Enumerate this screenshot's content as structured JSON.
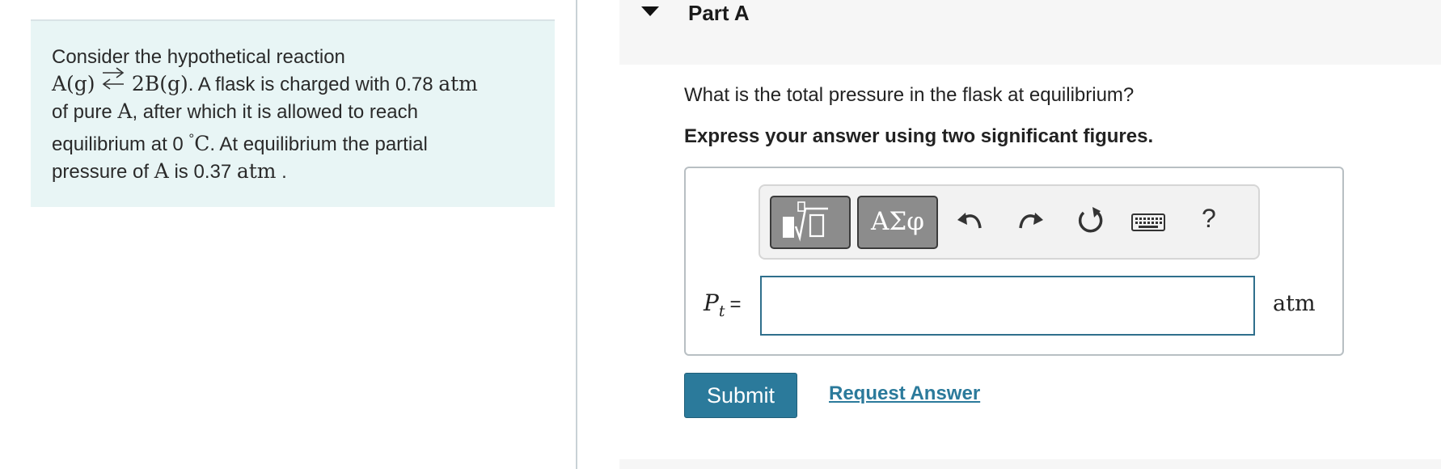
{
  "problem": {
    "intro": "Consider the hypothetical reaction",
    "reactant": "A(g)",
    "product": "2B(g)",
    "text_after_eq": ". A flask is charged with 0.78 ",
    "unit_atm_1": "atm",
    "line3_start": "of pure ",
    "species_a": "A",
    "line3_end": ", after which it is allowed to reach",
    "line4_start": "equilibrium at 0 ",
    "degree": "°",
    "celsius": "C",
    "line4_end": ". At equilibrium the partial",
    "line5_start": "pressure of ",
    "species_a2": "A",
    "line5_mid": " is 0.37 ",
    "unit_atm_2": "atm",
    "line5_end": " ."
  },
  "part": {
    "title": "Part A",
    "question": "What is the total pressure in the flask at equilibrium?",
    "instruction": "Express your answer using two significant figures."
  },
  "toolbar": {
    "greek_label": "ΑΣφ",
    "help_label": "?"
  },
  "answer": {
    "variable": "P",
    "subscript": "t",
    "equals": "=",
    "value": "",
    "unit": "atm"
  },
  "actions": {
    "submit_label": "Submit",
    "request_label": "Request Answer"
  },
  "colors": {
    "problem_bg": "#e8f5f5",
    "accent": "#2b7a9b"
  },
  "icons": [
    "templates-icon",
    "greek-symbols",
    "undo-icon",
    "redo-icon",
    "reset-icon",
    "keyboard-icon",
    "help-icon",
    "collapse-triangle-icon"
  ]
}
